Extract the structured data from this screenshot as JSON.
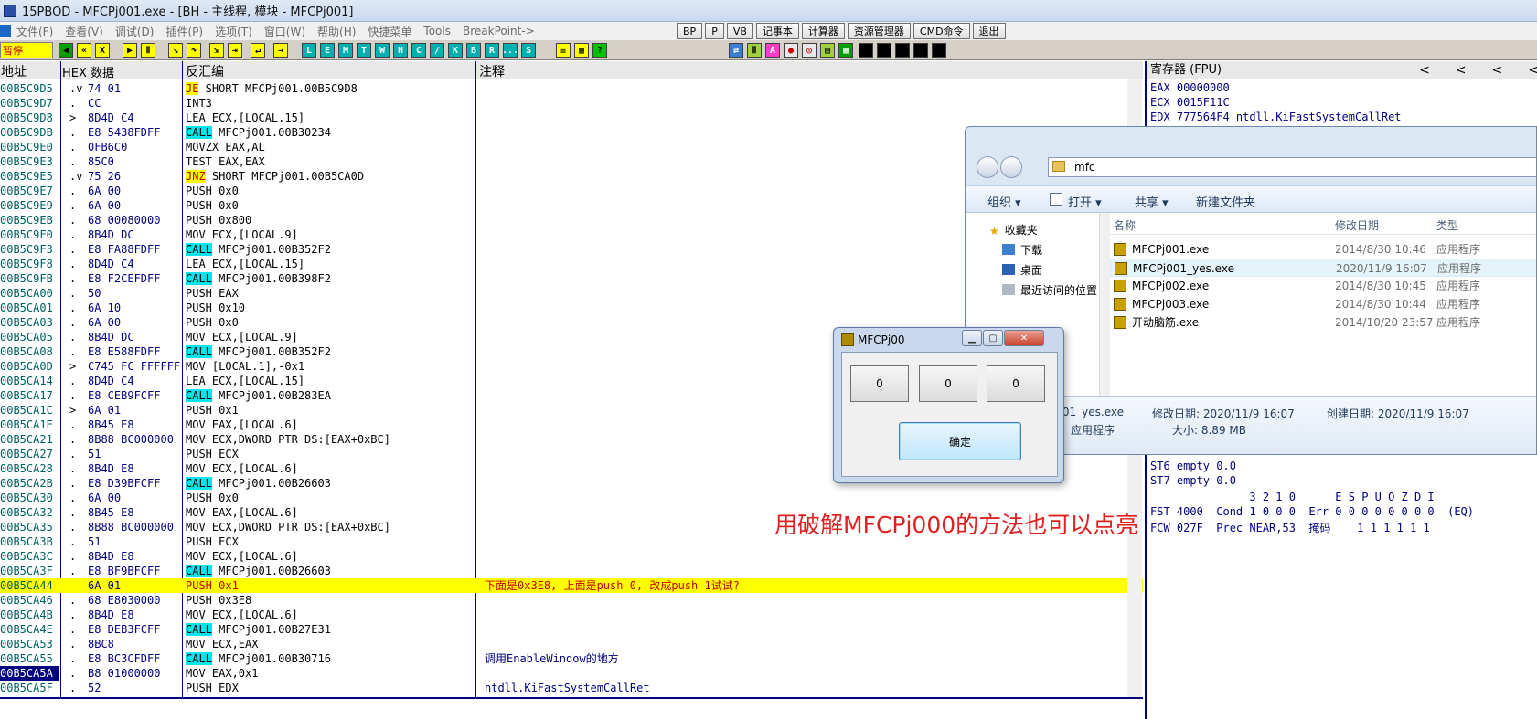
{
  "window_title": "15PBOD - MFCPj001.exe - [BH - 主线程, 模块 - MFCPj001]",
  "menu": [
    "文件(F)",
    "查看(V)",
    "调试(D)",
    "插件(P)",
    "选项(T)",
    "窗口(W)",
    "帮助(H)",
    "快捷菜单",
    "Tools",
    "BreakPoint->"
  ],
  "menu_buttons": [
    "BP",
    "P",
    "VB",
    "记事本",
    "计算器",
    "资源管理器",
    "CMD命令",
    "退出"
  ],
  "status_label": "暂停",
  "toolbar_letters": [
    "L",
    "E",
    "M",
    "T",
    "W",
    "H",
    "C",
    "/",
    "K",
    "B",
    "R",
    "...",
    "S"
  ],
  "cpu_columns": {
    "address": "地址",
    "hex": "HEX 数据",
    "disasm": "反汇编",
    "comment": "注释"
  },
  "rows": [
    {
      "addr": "00B5C9D5",
      "mark": ".v",
      "hex": "74 01",
      "kw": "JE",
      "kwtype": "jmp",
      "rest": " SHORT MFCPj001.00B5C9D8",
      "cmt": ""
    },
    {
      "addr": "00B5C9D7",
      "mark": ".",
      "hex": "CC",
      "kw": "",
      "kwtype": "",
      "rest": "INT3",
      "cmt": ""
    },
    {
      "addr": "00B5C9D8",
      "mark": ">",
      "hex": "8D4D C4",
      "kw": "",
      "kwtype": "",
      "rest": "LEA ECX,[LOCAL.15]",
      "cmt": ""
    },
    {
      "addr": "00B5C9DB",
      "mark": ".",
      "hex": "E8 5438FDFF",
      "kw": "CALL",
      "kwtype": "call",
      "rest": " MFCPj001.00B30234",
      "cmt": ""
    },
    {
      "addr": "00B5C9E0",
      "mark": ".",
      "hex": "0FB6C0",
      "kw": "",
      "kwtype": "",
      "rest": "MOVZX EAX,AL",
      "cmt": ""
    },
    {
      "addr": "00B5C9E3",
      "mark": ".",
      "hex": "85C0",
      "kw": "",
      "kwtype": "",
      "rest": "TEST EAX,EAX",
      "cmt": ""
    },
    {
      "addr": "00B5C9E5",
      "mark": ".v",
      "hex": "75 26",
      "kw": "JNZ",
      "kwtype": "jmp",
      "rest": " SHORT MFCPj001.00B5CA0D",
      "cmt": ""
    },
    {
      "addr": "00B5C9E7",
      "mark": ".",
      "hex": "6A 00",
      "kw": "",
      "kwtype": "",
      "rest": "PUSH 0x0",
      "cmt": ""
    },
    {
      "addr": "00B5C9E9",
      "mark": ".",
      "hex": "6A 00",
      "kw": "",
      "kwtype": "",
      "rest": "PUSH 0x0",
      "cmt": ""
    },
    {
      "addr": "00B5C9EB",
      "mark": ".",
      "hex": "68 00080000",
      "kw": "",
      "kwtype": "",
      "rest": "PUSH 0x800",
      "cmt": ""
    },
    {
      "addr": "00B5C9F0",
      "mark": ".",
      "hex": "8B4D DC",
      "kw": "",
      "kwtype": "",
      "rest": "MOV ECX,[LOCAL.9]",
      "cmt": ""
    },
    {
      "addr": "00B5C9F3",
      "mark": ".",
      "hex": "E8 FA88FDFF",
      "kw": "CALL",
      "kwtype": "call",
      "rest": " MFCPj001.00B352F2",
      "cmt": ""
    },
    {
      "addr": "00B5C9F8",
      "mark": ".",
      "hex": "8D4D C4",
      "kw": "",
      "kwtype": "",
      "rest": "LEA ECX,[LOCAL.15]",
      "cmt": ""
    },
    {
      "addr": "00B5C9FB",
      "mark": ".",
      "hex": "E8 F2CEFDFF",
      "kw": "CALL",
      "kwtype": "call",
      "rest": " MFCPj001.00B398F2",
      "cmt": ""
    },
    {
      "addr": "00B5CA00",
      "mark": ".",
      "hex": "50",
      "kw": "",
      "kwtype": "",
      "rest": "PUSH EAX",
      "cmt": ""
    },
    {
      "addr": "00B5CA01",
      "mark": ".",
      "hex": "6A 10",
      "kw": "",
      "kwtype": "",
      "rest": "PUSH 0x10",
      "cmt": ""
    },
    {
      "addr": "00B5CA03",
      "mark": ".",
      "hex": "6A 00",
      "kw": "",
      "kwtype": "",
      "rest": "PUSH 0x0",
      "cmt": ""
    },
    {
      "addr": "00B5CA05",
      "mark": ".",
      "hex": "8B4D DC",
      "kw": "",
      "kwtype": "",
      "rest": "MOV ECX,[LOCAL.9]",
      "cmt": ""
    },
    {
      "addr": "00B5CA08",
      "mark": ".",
      "hex": "E8 E588FDFF",
      "kw": "CALL",
      "kwtype": "call",
      "rest": " MFCPj001.00B352F2",
      "cmt": ""
    },
    {
      "addr": "00B5CA0D",
      "mark": ">",
      "hex": "C745 FC FFFFFFFF",
      "kw": "",
      "kwtype": "",
      "rest": "MOV [LOCAL.1],-0x1",
      "cmt": ""
    },
    {
      "addr": "00B5CA14",
      "mark": ".",
      "hex": "8D4D C4",
      "kw": "",
      "kwtype": "",
      "rest": "LEA ECX,[LOCAL.15]",
      "cmt": ""
    },
    {
      "addr": "00B5CA17",
      "mark": ".",
      "hex": "E8 CEB9FCFF",
      "kw": "CALL",
      "kwtype": "call",
      "rest": " MFCPj001.00B283EA",
      "cmt": ""
    },
    {
      "addr": "00B5CA1C",
      "mark": ">",
      "hex": "6A 01",
      "kw": "",
      "kwtype": "",
      "rest": "PUSH 0x1",
      "cmt": ""
    },
    {
      "addr": "00B5CA1E",
      "mark": ".",
      "hex": "8B45 E8",
      "kw": "",
      "kwtype": "",
      "rest": "MOV EAX,[LOCAL.6]",
      "cmt": ""
    },
    {
      "addr": "00B5CA21",
      "mark": ".",
      "hex": "8B88 BC000000",
      "kw": "",
      "kwtype": "",
      "rest": "MOV ECX,DWORD PTR DS:[EAX+0xBC]",
      "cmt": ""
    },
    {
      "addr": "00B5CA27",
      "mark": ".",
      "hex": "51",
      "kw": "",
      "kwtype": "",
      "rest": "PUSH ECX",
      "cmt": ""
    },
    {
      "addr": "00B5CA28",
      "mark": ".",
      "hex": "8B4D E8",
      "kw": "",
      "kwtype": "",
      "rest": "MOV ECX,[LOCAL.6]",
      "cmt": ""
    },
    {
      "addr": "00B5CA2B",
      "mark": ".",
      "hex": "E8 D39BFCFF",
      "kw": "CALL",
      "kwtype": "call",
      "rest": " MFCPj001.00B26603",
      "cmt": ""
    },
    {
      "addr": "00B5CA30",
      "mark": ".",
      "hex": "6A 00",
      "kw": "",
      "kwtype": "",
      "rest": "PUSH 0x0",
      "cmt": ""
    },
    {
      "addr": "00B5CA32",
      "mark": ".",
      "hex": "8B45 E8",
      "kw": "",
      "kwtype": "",
      "rest": "MOV EAX,[LOCAL.6]",
      "cmt": ""
    },
    {
      "addr": "00B5CA35",
      "mark": ".",
      "hex": "8B88 BC000000",
      "kw": "",
      "kwtype": "",
      "rest": "MOV ECX,DWORD PTR DS:[EAX+0xBC]",
      "cmt": ""
    },
    {
      "addr": "00B5CA3B",
      "mark": ".",
      "hex": "51",
      "kw": "",
      "kwtype": "",
      "rest": "PUSH ECX",
      "cmt": ""
    },
    {
      "addr": "00B5CA3C",
      "mark": ".",
      "hex": "8B4D E8",
      "kw": "",
      "kwtype": "",
      "rest": "MOV ECX,[LOCAL.6]",
      "cmt": ""
    },
    {
      "addr": "00B5CA3F",
      "mark": ".",
      "hex": "E8 BF9BFCFF",
      "kw": "CALL",
      "kwtype": "call",
      "rest": " MFCPj001.00B26603",
      "cmt": ""
    },
    {
      "addr": "00B5CA44",
      "mark": "",
      "hex": "6A 01",
      "kw": "",
      "kwtype": "",
      "rest": "PUSH 0x1",
      "cmt": "下面是0x3E8, 上面是push 0, 改成push 1试试?",
      "highlight": true
    },
    {
      "addr": "00B5CA46",
      "mark": ".",
      "hex": "68 E8030000",
      "kw": "",
      "kwtype": "",
      "rest": "PUSH 0x3E8",
      "cmt": ""
    },
    {
      "addr": "00B5CA4B",
      "mark": ".",
      "hex": "8B4D E8",
      "kw": "",
      "kwtype": "",
      "rest": "MOV ECX,[LOCAL.6]",
      "cmt": ""
    },
    {
      "addr": "00B5CA4E",
      "mark": ".",
      "hex": "E8 DEB3FCFF",
      "kw": "CALL",
      "kwtype": "call",
      "rest": " MFCPj001.00B27E31",
      "cmt": ""
    },
    {
      "addr": "00B5CA53",
      "mark": ".",
      "hex": "8BC8",
      "kw": "",
      "kwtype": "",
      "rest": "MOV ECX,EAX",
      "cmt": ""
    },
    {
      "addr": "00B5CA55",
      "mark": ".",
      "hex": "E8 BC3CFDFF",
      "kw": "CALL",
      "kwtype": "call",
      "rest": " MFCPj001.00B30716",
      "cmt": "调用EnableWindow的地方"
    },
    {
      "addr": "00B5CA5A",
      "mark": ".",
      "hex": "B8 01000000",
      "kw": "",
      "kwtype": "",
      "rest": "MOV EAX,0x1",
      "cmt": "",
      "selected": true
    },
    {
      "addr": "00B5CA5F",
      "mark": ".",
      "hex": "52",
      "kw": "",
      "kwtype": "",
      "rest": "PUSH EDX",
      "cmt": "ntdll.KiFastSystemCallRet"
    }
  ],
  "registers": {
    "title": "寄存器 (FPU)",
    "lines": [
      "EAX 00000000",
      "ECX 0015F11C",
      "EDX 777564F4 ntdll.KiFastSystemCallRet"
    ],
    "fpu_lines": [
      "ST6 empty 0.0",
      "ST7 empty 0.0",
      "               3 2 1 0      E S P U O Z D I",
      "FST 4000  Cond 1 0 0 0  Err 0 0 0 0 0 0 0 0  (EQ)",
      "FCW 027F  Prec NEAR,53  掩码    1 1 1 1 1 1"
    ]
  },
  "explorer": {
    "path": "mfc",
    "commands": [
      "组织 ▾",
      "打开 ▾",
      "共享 ▾",
      "新建文件夹"
    ],
    "nav": [
      "收藏夹",
      "下载",
      "桌面",
      "最近访问的位置"
    ],
    "columns": {
      "name": "名称",
      "date": "修改日期",
      "type": "类型"
    },
    "files": [
      {
        "name": "MFCPj001.exe",
        "date": "2014/8/30 10:46",
        "type": "应用程序"
      },
      {
        "name": "MFCPj001_yes.exe",
        "date": "2020/11/9 16:07",
        "type": "应用程序"
      },
      {
        "name": "MFCPj002.exe",
        "date": "2014/8/30 10:45",
        "type": "应用程序"
      },
      {
        "name": "MFCPj003.exe",
        "date": "2014/8/30 10:44",
        "type": "应用程序"
      },
      {
        "name": "开动脑筋.exe",
        "date": "2014/10/20 23:57",
        "type": "应用程序"
      }
    ],
    "details": {
      "name": "MFCPj001_yes.exe",
      "modified": "修改日期: 2020/11/9 16:07",
      "created": "创建日期: 2020/11/9 16:07",
      "type": "应用程序",
      "size": "大小: 8.89 MB"
    }
  },
  "dialog": {
    "title": "MFCPj00",
    "buttons": [
      "0",
      "0",
      "0"
    ],
    "ok": "确定"
  },
  "annotation": "用破解MFCPj000的方法也可以点亮",
  "colors": {
    "call": "#00e5ee",
    "jump": "#ffff00",
    "highlight_row": "#ffff00",
    "annotation": "#e02020"
  }
}
